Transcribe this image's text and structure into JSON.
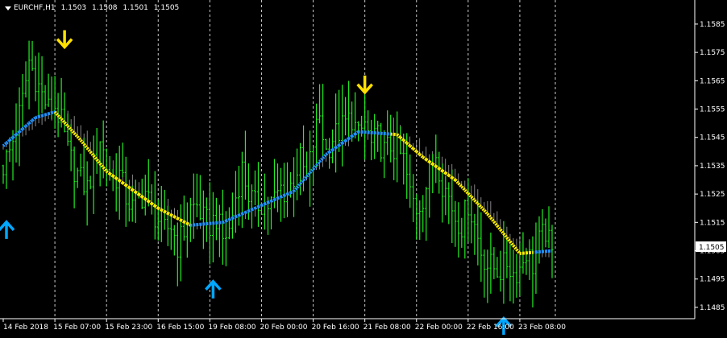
{
  "colors": {
    "background": "#000000",
    "axis": "#ffffff",
    "grid": "#c8c8c8",
    "candle": "#22ee22",
    "trend_up": "#1e90ff",
    "trend_down": "#ffee00",
    "arrow_up": "#00a8ff",
    "arrow_down": "#ffe000",
    "price_box_bg": "#ffffff",
    "price_box_text": "#000000"
  },
  "header": {
    "symbol": "EURCHF,H1",
    "open": "1.1503",
    "high": "1.1508",
    "low": "1.1501",
    "close": "1.1505"
  },
  "icons": {
    "menu": "triangle-down-icon",
    "buy_signal": "arrow-up-icon",
    "sell_signal": "arrow-down-icon"
  },
  "current_price_label": "1.1505",
  "chart_data": {
    "type": "line",
    "title": "",
    "xlabel": "",
    "ylabel": "",
    "grid": true,
    "ylim": [
      1.1481,
      1.15935
    ],
    "y_ticks": [
      "1.1585",
      "1.1575",
      "1.1565",
      "1.1555",
      "1.1545",
      "1.1535",
      "1.1525",
      "1.1515",
      "1.1505",
      "1.1495",
      "1.1485"
    ],
    "x_ticks": [
      "14 Feb 2018",
      "15 Feb 07:00",
      "15 Feb 23:00",
      "16 Feb 15:00",
      "19 Feb 08:00",
      "20 Feb 00:00",
      "20 Feb 16:00",
      "21 Feb 08:00",
      "22 Feb 00:00",
      "22 Feb 16:00",
      "23 Feb 08:00"
    ],
    "x_tick_index": [
      0,
      16,
      32,
      48,
      64,
      80,
      96,
      112,
      128,
      144,
      160
    ],
    "bars_count": 171,
    "price_anchors": [
      [
        0,
        1.1535
      ],
      [
        2,
        1.154
      ],
      [
        4,
        1.1548
      ],
      [
        6,
        1.1558
      ],
      [
        8,
        1.1572
      ],
      [
        10,
        1.1566
      ],
      [
        12,
        1.156
      ],
      [
        14,
        1.1555
      ],
      [
        16,
        1.1556
      ],
      [
        18,
        1.155
      ],
      [
        20,
        1.154
      ],
      [
        22,
        1.1534
      ],
      [
        24,
        1.153
      ],
      [
        26,
        1.1527
      ],
      [
        28,
        1.1535
      ],
      [
        30,
        1.1545
      ],
      [
        32,
        1.1535
      ],
      [
        34,
        1.153
      ],
      [
        36,
        1.1532
      ],
      [
        38,
        1.1524
      ],
      [
        40,
        1.152
      ],
      [
        42,
        1.1523
      ],
      [
        44,
        1.1526
      ],
      [
        46,
        1.1519
      ],
      [
        48,
        1.1516
      ],
      [
        50,
        1.1512
      ],
      [
        52,
        1.1514
      ],
      [
        54,
        1.1507
      ],
      [
        56,
        1.1512
      ],
      [
        58,
        1.152
      ],
      [
        60,
        1.1521
      ],
      [
        62,
        1.1516
      ],
      [
        64,
        1.1514
      ],
      [
        66,
        1.1517
      ],
      [
        68,
        1.1509
      ],
      [
        70,
        1.1512
      ],
      [
        72,
        1.1524
      ],
      [
        74,
        1.1534
      ],
      [
        76,
        1.1525
      ],
      [
        78,
        1.1521
      ],
      [
        80,
        1.1522
      ],
      [
        82,
        1.1521
      ],
      [
        84,
        1.1523
      ],
      [
        86,
        1.1527
      ],
      [
        88,
        1.1525
      ],
      [
        90,
        1.1531
      ],
      [
        92,
        1.1537
      ],
      [
        94,
        1.153
      ],
      [
        96,
        1.1543
      ],
      [
        98,
        1.1553
      ],
      [
        100,
        1.154
      ],
      [
        102,
        1.1545
      ],
      [
        104,
        1.1547
      ],
      [
        106,
        1.155
      ],
      [
        108,
        1.1552
      ],
      [
        110,
        1.1545
      ],
      [
        112,
        1.155
      ],
      [
        114,
        1.1542
      ],
      [
        116,
        1.1545
      ],
      [
        118,
        1.154
      ],
      [
        120,
        1.1542
      ],
      [
        122,
        1.154
      ],
      [
        124,
        1.1537
      ],
      [
        126,
        1.1525
      ],
      [
        128,
        1.152
      ],
      [
        130,
        1.1524
      ],
      [
        132,
        1.1532
      ],
      [
        134,
        1.154
      ],
      [
        136,
        1.1529
      ],
      [
        138,
        1.1524
      ],
      [
        140,
        1.1517
      ],
      [
        142,
        1.1514
      ],
      [
        144,
        1.1522
      ],
      [
        146,
        1.1514
      ],
      [
        148,
        1.1505
      ],
      [
        150,
        1.15
      ],
      [
        152,
        1.1499
      ],
      [
        154,
        1.1498
      ],
      [
        156,
        1.1501
      ],
      [
        158,
        1.1497
      ],
      [
        160,
        1.1499
      ],
      [
        162,
        1.1505
      ],
      [
        164,
        1.15
      ],
      [
        166,
        1.1508
      ],
      [
        168,
        1.1512
      ],
      [
        170,
        1.1503
      ]
    ],
    "trend_anchors": [
      [
        0,
        1.1542
      ],
      [
        10,
        1.1552
      ],
      [
        16,
        1.1554
      ],
      [
        24,
        1.1544
      ],
      [
        32,
        1.1533
      ],
      [
        48,
        1.152
      ],
      [
        58,
        1.1514
      ],
      [
        68,
        1.1515
      ],
      [
        80,
        1.1521
      ],
      [
        90,
        1.1526
      ],
      [
        100,
        1.1539
      ],
      [
        110,
        1.1547
      ],
      [
        122,
        1.1546
      ],
      [
        130,
        1.1538
      ],
      [
        140,
        1.153
      ],
      [
        150,
        1.1518
      ],
      [
        160,
        1.1504
      ],
      [
        170,
        1.1505
      ]
    ],
    "trend_down_ranges": [
      [
        16,
        57
      ],
      [
        120,
        163
      ]
    ],
    "signals": [
      {
        "type": "buy",
        "bar": 1,
        "price": 1.1512
      },
      {
        "type": "sell",
        "bar": 19,
        "price": 1.158
      },
      {
        "type": "buy",
        "bar": 65,
        "price": 1.1491
      },
      {
        "type": "sell",
        "bar": 112,
        "price": 1.1564
      },
      {
        "type": "buy",
        "bar": 155,
        "price": 1.1478
      }
    ]
  }
}
